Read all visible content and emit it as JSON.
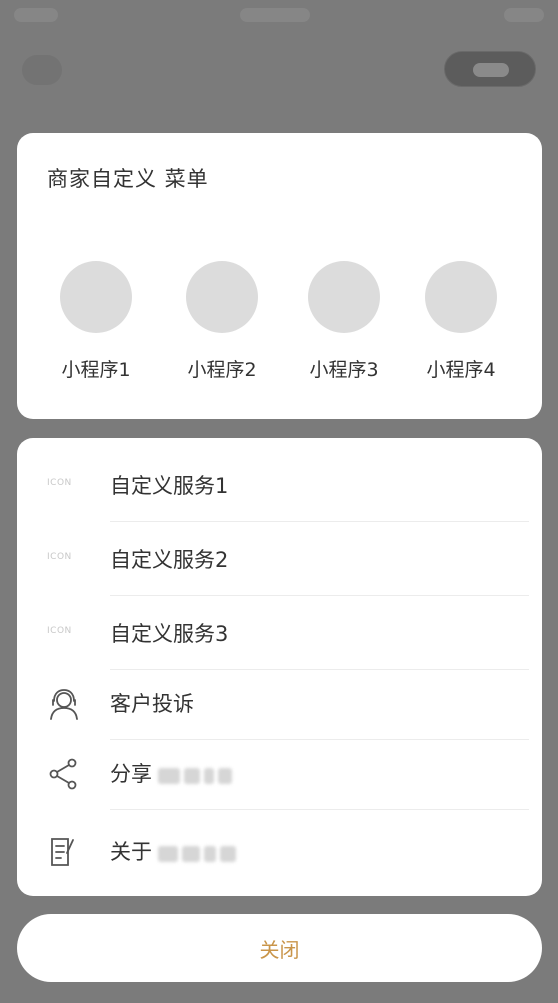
{
  "menu": {
    "title": "商家自定义 菜单",
    "mini_programs": [
      {
        "label": "小程序1"
      },
      {
        "label": "小程序2"
      },
      {
        "label": "小程序3"
      },
      {
        "label": "小程序4"
      }
    ]
  },
  "services": [
    {
      "icon": "placeholder-icon",
      "icon_text": "ICON",
      "label": "自定义服务1"
    },
    {
      "icon": "placeholder-icon",
      "icon_text": "ICON",
      "label": "自定义服务2"
    },
    {
      "icon": "placeholder-icon",
      "icon_text": "ICON",
      "label": "自定义服务3"
    },
    {
      "icon": "customer-service-icon",
      "label": "客户投诉"
    },
    {
      "icon": "share-icon",
      "label": "分享"
    },
    {
      "icon": "about-icon",
      "label": "关于"
    }
  ],
  "close_label": "关闭",
  "colors": {
    "overlay": "#7b7b7b",
    "close_text": "#c9954a",
    "placeholder": "#dcdcdc"
  }
}
